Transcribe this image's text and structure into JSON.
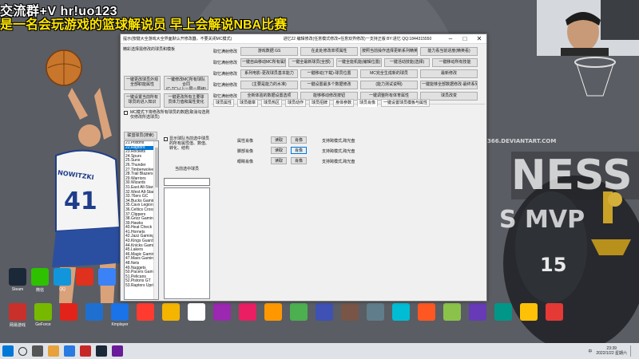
{
  "overlay": {
    "line1": "交流群+V hr!uo123",
    "line2": "是一名会玩游戏的篮球解说员 早上会解说NBA比赛"
  },
  "wallpaper": {
    "deviantart": "366.DEVIANTART.COM",
    "big_text": "NESS",
    "mvp_text": "S MVP",
    "jersey_back": "NOWITZKI",
    "jersey_number": "41",
    "jersey_front": "15"
  },
  "desktop_icons_row1": [
    {
      "label": "Steam",
      "color": "#1b2838"
    },
    {
      "label": "微信",
      "color": "#2dc100"
    },
    {
      "label": "QQ",
      "color": "#1296db"
    },
    {
      "label": "",
      "color": "#e0301e"
    },
    {
      "label": "",
      "color": "#3b82f6"
    }
  ],
  "desktop_icons_row2": [
    {
      "label": "网易游戏",
      "color": "#c9302c"
    },
    {
      "label": "GeForce",
      "color": "#76b900"
    },
    {
      "label": "",
      "color": "#e2231a"
    },
    {
      "label": "",
      "color": "#1f6fd0"
    },
    {
      "label": "Kmplayer",
      "color": "#1a73e8"
    },
    {
      "label": "",
      "color": "#ff3b30"
    },
    {
      "label": "",
      "color": "#f4b400"
    },
    {
      "label": "",
      "color": "#ffffff"
    },
    {
      "label": "",
      "color": "#9c27b0"
    },
    {
      "label": "",
      "color": "#e91e63"
    },
    {
      "label": "",
      "color": "#ff9800"
    },
    {
      "label": "",
      "color": "#4caf50"
    },
    {
      "label": "",
      "color": "#3f51b5"
    },
    {
      "label": "",
      "color": "#795548"
    },
    {
      "label": "",
      "color": "#607d8b"
    },
    {
      "label": "",
      "color": "#00bcd4"
    },
    {
      "label": "",
      "color": "#ff5722"
    },
    {
      "label": "",
      "color": "#8bc34a"
    },
    {
      "label": "",
      "color": "#673ab7"
    },
    {
      "label": "",
      "color": "#009688"
    },
    {
      "label": "",
      "color": "#ffc107"
    },
    {
      "label": "",
      "color": "#e53935"
    }
  ],
  "app": {
    "title": "提示(按键大全游戏大全界面默认开修改器，不要关闭MC模式)",
    "title_mid": "进忆22 编辑修改(任意模式修改+任意双界修改)一支持正版 BY:进忆 QQ:1844315550",
    "left_hint": "精彩选择需修改的球员和模板",
    "left_buttons": [
      "一键更改球员外观\n全部职能属性",
      "一键修改MC所有球队合同\n(C-TC)-(上一层一层级)",
      "一键设置当前所有\n球员的进入知识",
      "一键更改所有主要球\n员体力值和属性变化"
    ],
    "mc_check": "MC模式下将修改所有球员的数据(取消勾选则仅修改所选球员)",
    "team_btn": "联盟球员(搜索)",
    "teams": [
      "21.Pistons",
      "22.Raptors",
      "23.Rockets",
      "24.Spurs",
      "25.Suns",
      "26.Thunder",
      "27.Timberwolves",
      "28.Trail Blazers",
      "29.Warriors",
      "30.Wizards",
      "31.East All-Stars",
      "32.West All-Stars",
      "33.76ers GC",
      "34.Bucks Gaming",
      "35.Cavs Legion",
      "36.Celtics Crossover",
      "37.Clippers",
      "38.Grizz Gaming",
      "39.Hawks",
      "40.Heat Check",
      "41.Hornets",
      "42.Jazz Gaming",
      "43.Kings Guard",
      "44.Knicks Gaming",
      "45.Lakers",
      "46.Magic Gaming",
      "47.Mavs Gaming",
      "48.Nets",
      "49.Nuggets",
      "50.Pacers Gaming",
      "51.Pelicans",
      "52.Pistons GT",
      "53.Raptors Uprising"
    ],
    "selected_team_index": 1,
    "mid_check": "显示球队当前选中球员的所有属性值、数值、转化、结构",
    "mid_label": "当前选中球员",
    "rows": [
      {
        "label": "取忆满射修改",
        "items": [
          "游戏数据 GS",
          "在此处修改单项属性",
          "按照当前操作选择更新系列精英(更及知修改)",
          "能力看当前进度(精英看)"
        ]
      },
      {
        "label": "取忆满射修改",
        "items": [
          "一键自由移动MC所有属性值",
          "一键全最新球员(全部)",
          "一键全能机能(编辑位置)",
          "一键活动技能(选择)",
          "一键移动所有技能"
        ]
      },
      {
        "label": "取忆满射修改",
        "items": [
          "系列电影-更改球员基本能力",
          "一键移动(下载)-球员位置",
          "MC完全生成新的球员",
          "最新修改"
        ]
      },
      {
        "label": "取忆满射修改",
        "items": [
          "(主要是能力的水准)",
          "一键设置最多个数据修改",
          "(能力测试说明)",
          "一键能够全部数据修改-最终系列"
        ]
      },
      {
        "label": "取忆满射修改",
        "items": [
          "全新体验的数据设置选项",
          "能够移动修改按钮",
          "一键调整所有体育属性",
          "球员改变"
        ]
      }
    ],
    "tabs": [
      "球员属性",
      "球员徽章",
      "球员热区",
      "球员动作",
      "球员招牌",
      "身体参数",
      "球员肖像",
      "一键设置球员模板与属性"
    ],
    "active_tab_index": 6,
    "attr_rows": [
      {
        "name": "属性肖像",
        "btn1": "读取",
        "btn2": "肖像",
        "hint": "支持跨模式,跨光盘"
      },
      {
        "name": "脚部肖像",
        "btn1": "读取",
        "btn2": "肖像",
        "hint": "支持跨模式,跨光盘"
      },
      {
        "name": "眼睛肖像",
        "btn1": "读取",
        "btn2": "肖像",
        "hint": "支持跨模式,跨光盘"
      }
    ]
  },
  "taskbar": {
    "tray_text": "中",
    "time": "23:39",
    "date": "2022/1/22 星期六"
  }
}
